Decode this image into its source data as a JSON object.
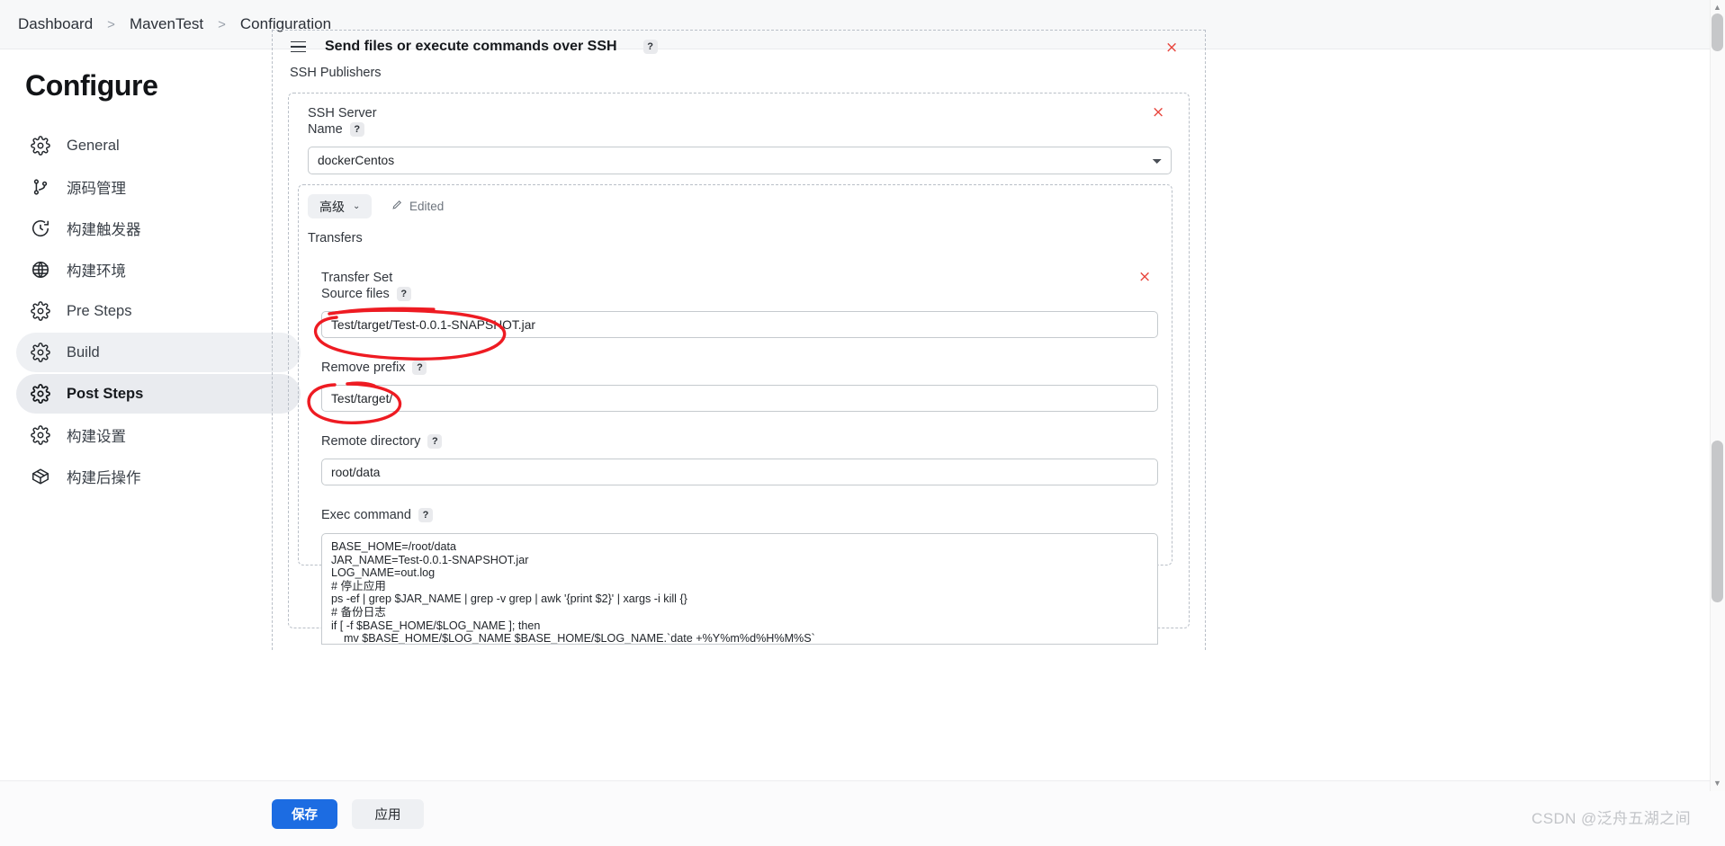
{
  "breadcrumb": {
    "items": [
      "Dashboard",
      "MavenTest",
      "Configuration"
    ],
    "separator": ">"
  },
  "sidebar": {
    "title": "Configure",
    "items": [
      {
        "label": "General",
        "icon": "gear-icon",
        "state": "normal"
      },
      {
        "label": "源码管理",
        "icon": "git-branch-icon",
        "state": "normal"
      },
      {
        "label": "构建触发器",
        "icon": "clock-icon",
        "state": "normal"
      },
      {
        "label": "构建环境",
        "icon": "globe-icon",
        "state": "normal"
      },
      {
        "label": "Pre Steps",
        "icon": "gear-icon",
        "state": "normal"
      },
      {
        "label": "Build",
        "icon": "gear-icon",
        "state": "active-soft"
      },
      {
        "label": "Post Steps",
        "icon": "gear-icon",
        "state": "active-strong"
      },
      {
        "label": "构建设置",
        "icon": "gear-icon",
        "state": "normal"
      },
      {
        "label": "构建后操作",
        "icon": "package-icon",
        "state": "normal"
      }
    ]
  },
  "main": {
    "section": {
      "title": "Send files or execute commands over SSH",
      "help": "?",
      "drag_handle": "hamburger-icon",
      "close": "×"
    },
    "publishers_label": "SSH Publishers",
    "ssh_server": {
      "group_label": "SSH Server",
      "name_label": "Name",
      "name_help": "?",
      "name_value": "dockerCentos",
      "name_options": [
        "dockerCentos"
      ],
      "close": "×",
      "advanced_label": "高级",
      "advanced_chevron": "⌄",
      "edited_label": "Edited",
      "edited_icon": "pencil-icon"
    },
    "transfers_label": "Transfers",
    "transfer_set": {
      "group_label": "Transfer Set",
      "close": "×",
      "source_files": {
        "label": "Source files",
        "help": "?",
        "value": "Test/target/Test-0.0.1-SNAPSHOT.jar"
      },
      "remove_prefix": {
        "label": "Remove prefix",
        "help": "?",
        "value": "Test/target/"
      },
      "remote_directory": {
        "label": "Remote directory",
        "help": "?",
        "value": "root/data"
      },
      "exec_command": {
        "label": "Exec command",
        "help": "?",
        "value": "BASE_HOME=/root/data\nJAR_NAME=Test-0.0.1-SNAPSHOT.jar\nLOG_NAME=out.log\n# 停止应用\nps -ef | grep $JAR_NAME | grep -v grep | awk '{print $2}' | xargs -i kill {}\n# 备份日志\nif [ -f $BASE_HOME/$LOG_NAME ]; then\n    mv $BASE_HOME/$LOG_NAME $BASE_HOME/$LOG_NAME.`date +%Y%m%d%H%M%S`"
      }
    }
  },
  "footer": {
    "save_label": "保存",
    "apply_label": "应用"
  },
  "watermark": "CSDN @泛舟五湖之间",
  "colors": {
    "accent": "#1c6ce2",
    "danger": "#e8453c",
    "annotation": "#ee1b22",
    "sidebar_active": "#e9ebef",
    "panel_bg": "#ffffff",
    "breadcrumb_bg": "#f7f8f9"
  },
  "annotations": [
    {
      "name": "source-files-circle",
      "shape": "hand-drawn-ellipse",
      "color": "#ee1b22"
    },
    {
      "name": "remove-prefix-circle",
      "shape": "hand-drawn-ellipse",
      "color": "#ee1b22"
    }
  ]
}
